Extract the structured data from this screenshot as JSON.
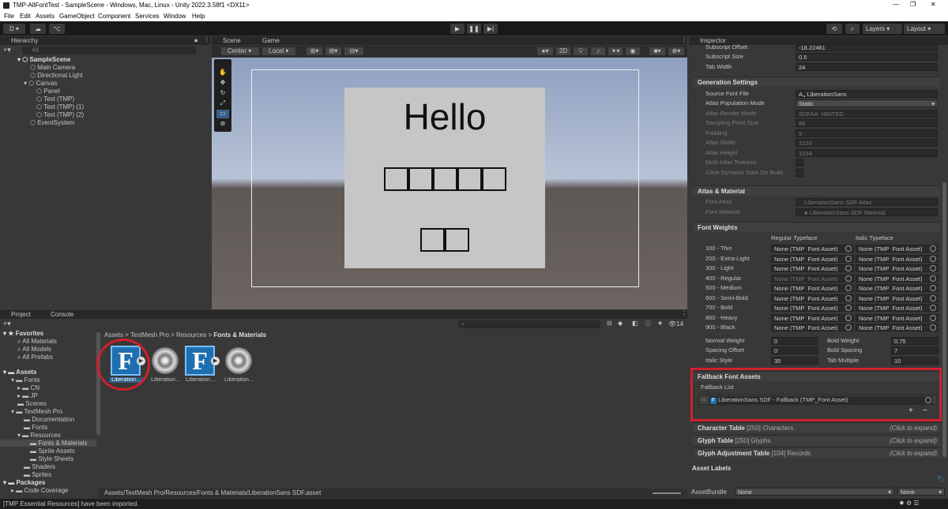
{
  "title": "TMP-AllFontTest - SampleScene - Windows, Mac, Linux - Unity 2022.3.58f1 <DX11>",
  "menu": [
    "File",
    "Edit",
    "Assets",
    "GameObject",
    "Component",
    "Services",
    "Window",
    "Help"
  ],
  "toolbar": {
    "account": "D",
    "layers": "Layers",
    "layout": "Layout"
  },
  "hierarchy": {
    "tab": "Hierarchy",
    "search": "All",
    "items": [
      "SampleScene",
      "Main Camera",
      "Directional Light",
      "Canvas",
      "Panel",
      "Text (TMP)",
      "Text (TMP) (1)",
      "Text (TMP) (2)",
      "EventSystem"
    ]
  },
  "scene": {
    "tabs": [
      "Scene",
      "Game"
    ],
    "pivot": "Center",
    "space": "Local",
    "mode2d": "2D",
    "hello": "Hello"
  },
  "project": {
    "tabs": [
      "Project",
      "Console"
    ],
    "favorites": "Favorites",
    "fav_items": [
      "All Materials",
      "All Models",
      "All Prefabs"
    ],
    "assets": "Assets",
    "asset_tree": [
      "Fonts",
      "CN",
      "JP",
      "Scenes",
      "TextMesh Pro",
      "Documentation",
      "Fonts",
      "Resources",
      "Fonts & Materials",
      "Sprite Assets",
      "Style Sheets",
      "Shaders",
      "Sprites"
    ],
    "packages": "Packages",
    "pkg_items": [
      "Code Coverage"
    ],
    "breadcrumb": [
      "Assets",
      "TextMesh Pro",
      "Resources",
      "Fonts & Materials"
    ],
    "files": [
      "Liberation…",
      "Liberation…",
      "Liberation…",
      "Liberation…"
    ],
    "count": "14",
    "path": "Assets/TextMesh Pro/Resources/Fonts & Materials/LiberationSans SDF.asset"
  },
  "status": "[TMP Essential Resources] have been imported.",
  "inspector": {
    "tab": "Inspector",
    "top_rows": [
      {
        "label": "Subscript Offset",
        "value": "-18.22461"
      },
      {
        "label": "Subscript Size",
        "value": "0.5"
      },
      {
        "label": "Tab Width",
        "value": "24"
      }
    ],
    "gen_title": "Generation Settings",
    "gen_rows": [
      {
        "label": "Source Font File",
        "value": "LiberationSans"
      },
      {
        "label": "Atlas Population Mode",
        "value": "Static"
      },
      {
        "label": "Atlas Render Mode",
        "value": "SDFAA_HINTED"
      },
      {
        "label": "Sampling Point Size",
        "value": "86"
      },
      {
        "label": "Padding",
        "value": "9"
      },
      {
        "label": "Atlas Width",
        "value": "1024"
      },
      {
        "label": "Atlas Height",
        "value": "1024"
      },
      {
        "label": "Multi Atlas Textures",
        "value": ""
      },
      {
        "label": "Clear Dynamic Data On Build",
        "value": ""
      }
    ],
    "atlas_title": "Atlas & Material",
    "atlas_rows": [
      {
        "label": "Font Atlas",
        "value": "LiberationSans SDF Atlas"
      },
      {
        "label": "Font Material",
        "value": "LiberationSans SDF Material"
      }
    ],
    "fw_title": "Font Weights",
    "fw_reg": "Regular Typeface",
    "fw_ital": "Italic Typeface",
    "fw_rows": [
      {
        "label": "100 - Thin",
        "reg": "None (TMP_Font Asset)",
        "ital": "None (TMP_Font Asset)"
      },
      {
        "label": "200 - Extra-Light",
        "reg": "None (TMP_Font Asset)",
        "ital": "None (TMP_Font Asset)"
      },
      {
        "label": "300 - Light",
        "reg": "None (TMP_Font Asset)",
        "ital": "None (TMP_Font Asset)"
      },
      {
        "label": "400 - Regular",
        "reg": "None (TMP_Font Asset)",
        "ital": "None (TMP_Font Asset)"
      },
      {
        "label": "500 - Medium",
        "reg": "None (TMP_Font Asset)",
        "ital": "None (TMP_Font Asset)"
      },
      {
        "label": "600 - Semi-Bold",
        "reg": "None (TMP_Font Asset)",
        "ital": "None (TMP_Font Asset)"
      },
      {
        "label": "700 - Bold",
        "reg": "None (TMP_Font Asset)",
        "ital": "None (TMP_Font Asset)"
      },
      {
        "label": "800 - Heavy",
        "reg": "None (TMP_Font Asset)",
        "ital": "None (TMP_Font Asset)"
      },
      {
        "label": "900 - Black",
        "reg": "None (TMP_Font Asset)",
        "ital": "None (TMP_Font Asset)"
      }
    ],
    "weights": [
      {
        "label": "Normal Weight",
        "value": "0",
        "label2": "Bold Weight",
        "value2": "0.75"
      },
      {
        "label": "Spacing Offset",
        "value": "0",
        "label2": "Bold Spacing",
        "value2": "7"
      },
      {
        "label": "Italic Style",
        "value": "35",
        "label2": "Tab Multiple",
        "value2": "10"
      }
    ],
    "fallback_title": "Fallback Font Assets",
    "fallback_list": "Fallback List",
    "fallback_item": "LiberationSans SDF - Fallback (TMP_Font Asset)",
    "char_table": {
      "label": "Character Table",
      "count": "[250] Characters",
      "hint": "(Click to expand)"
    },
    "glyph_table": {
      "label": "Glyph Table",
      "count": "[250] Glyphs",
      "hint": "(Click to expand)"
    },
    "glyph_adj": {
      "label": "Glyph Adjustment Table",
      "count": "[104] Records",
      "hint": "(Click to expand)"
    },
    "asset_labels": "Asset Labels",
    "asset_bundle": "AssetBundle",
    "bundle_val": "None",
    "bundle_val2": "None"
  },
  "colors": {
    "highlight": "#d0202a",
    "accent": "#2a8fd6"
  }
}
